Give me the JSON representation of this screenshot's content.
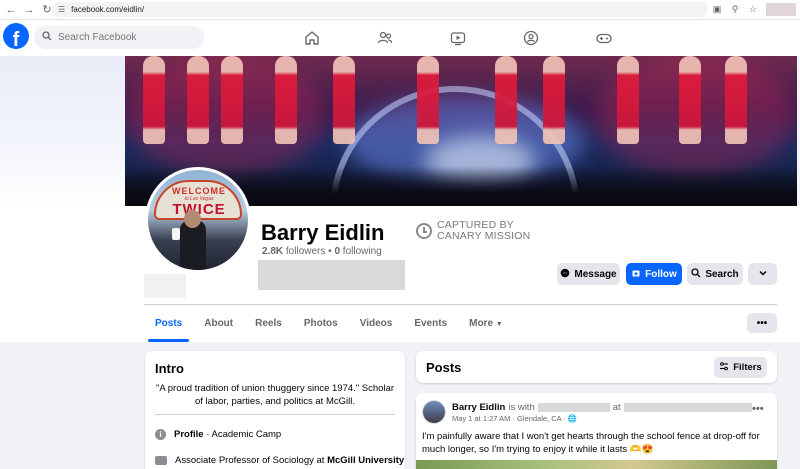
{
  "browser": {
    "back_icon": "arrow-left-icon",
    "forward_icon": "arrow-right-icon",
    "reload_icon": "reload-icon",
    "url": "facebook.com/eidlin/"
  },
  "fb_nav": {
    "logo_letter": "f",
    "search_placeholder": "Search Facebook",
    "icons": [
      "home-icon",
      "friends-icon",
      "watch-icon",
      "groups-icon",
      "gaming-icon"
    ]
  },
  "profile": {
    "name": "Barry Eidlin",
    "followers": "2.8K",
    "followers_label": "followers",
    "following": "0",
    "following_label": "following",
    "separator": "•",
    "avatar_sign_welcome": "WELCOME",
    "avatar_sign_sub": "to Las Vegas",
    "avatar_sign_twice": "TWICE"
  },
  "watermark": {
    "line1": "CAPTURED BY",
    "line2": "CANARY MISSION"
  },
  "actions": {
    "message": "Message",
    "follow": "Follow",
    "search": "Search"
  },
  "tabs": [
    {
      "label": "Posts",
      "active": true
    },
    {
      "label": "About"
    },
    {
      "label": "Reels"
    },
    {
      "label": "Photos"
    },
    {
      "label": "Videos"
    },
    {
      "label": "Events"
    },
    {
      "label": "More"
    }
  ],
  "more_dots": "•••",
  "intro": {
    "title": "Intro",
    "bio": "\"A proud tradition of union thuggery since 1974.\" Scholar of labor, parties, and politics at McGill.",
    "profile_label": "Profile",
    "profile_sep": " · ",
    "profile_value": "Academic Camp",
    "job_prefix": "Associate Professor of Sociology at ",
    "job_org": "McGill University"
  },
  "posts_section": {
    "title": "Posts",
    "filters": "Filters"
  },
  "post": {
    "author": "Barry Eidlin",
    "is_with": "is with",
    "at": "at",
    "meta": "May 1 at 1:27 AM · Glendale, CA · ",
    "text": "I'm painfully aware that I won't get hearts through the school fence at drop-off for much longer, so I'm trying to enjoy it while it lasts 🫶😍",
    "dots": "•••"
  },
  "colors": {
    "brand": "#0866ff",
    "page_bg": "#f0f2f5"
  }
}
